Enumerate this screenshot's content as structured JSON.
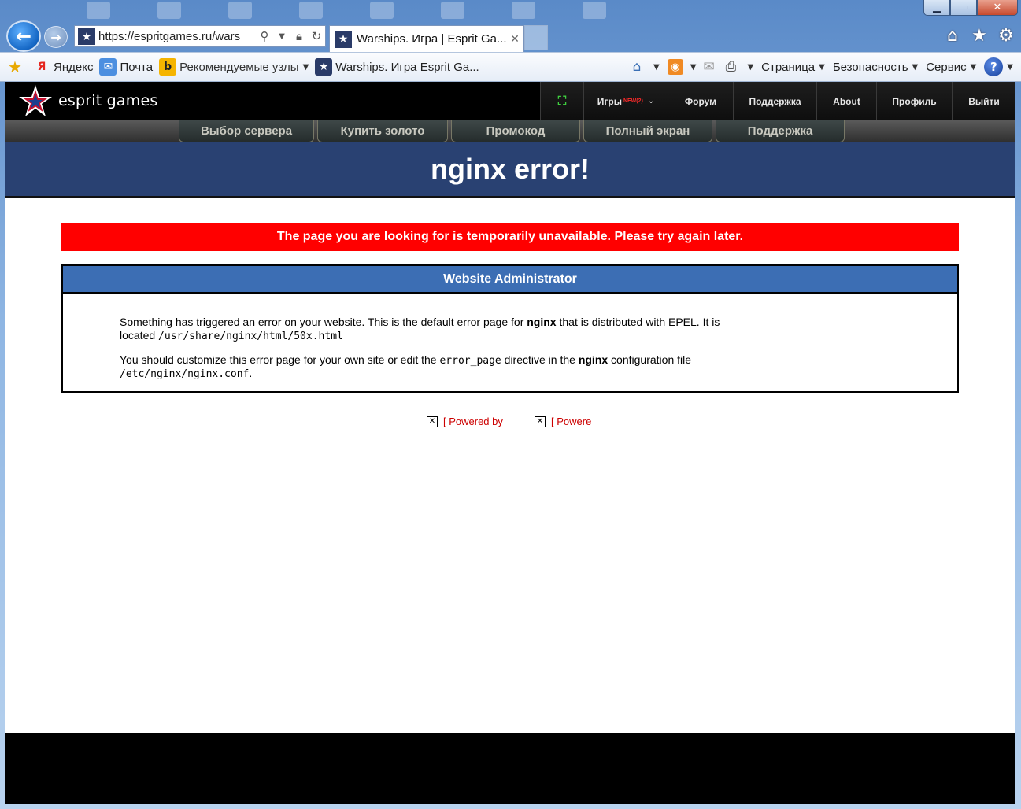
{
  "browser": {
    "address_url": "https://espritgames.ru/wars",
    "tab_title": "Warships. Игра | Esprit Ga...",
    "tab_close": "✕",
    "window_buttons": {
      "minimize": "▁",
      "maximize": "▭",
      "close": "✕"
    },
    "nav_right_icons": [
      "home-icon",
      "favorites-star-icon",
      "settings-gear-icon"
    ]
  },
  "favorites_bar": {
    "items": [
      {
        "label": "Яндекс",
        "icon": "yandex-icon"
      },
      {
        "label": "Почта",
        "icon": "mail-icon"
      },
      {
        "label": "Рекомендуемые узлы",
        "icon": "bing-icon"
      },
      {
        "label": "Warships. Игра  Esprit Ga...",
        "icon": "site-favicon-icon"
      }
    ],
    "commands": {
      "page": "Страница",
      "security": "Безопасность",
      "tools": "Сервис"
    }
  },
  "site": {
    "logo_text": "esprit games",
    "nav": {
      "games": "Игры",
      "games_badge": "NEW(2)",
      "forum": "Форум",
      "support": "Поддержка",
      "about": "About",
      "profile": "Профиль",
      "exit": "Выйти"
    },
    "subnav": [
      "Выбор сервера",
      "Купить золото",
      "Промокод",
      "Полный экран",
      "Поддержка"
    ]
  },
  "error_page": {
    "title": "nginx error!",
    "alert": "The page you are looking for is temporarily unavailable. Please try again later.",
    "admin_header": "Website Administrator",
    "p1_a": "Something has triggered an error on your website. This is the default error page for ",
    "p1_b": "nginx",
    "p1_c": " that is distributed with EPEL. It is located ",
    "p1_path": "/usr/share/nginx/html/50x.html",
    "p2_a": "You should customize this error page for your own site or edit the ",
    "p2_code": "error_page",
    "p2_b": " directive in the ",
    "p2_c": "nginx",
    "p2_d": " configuration file ",
    "p2_path": "/etc/nginx/nginx.conf",
    "p2_end": ".",
    "powered_1": "[ Powered by",
    "powered_2": "[ Powere"
  },
  "colors": {
    "banner": "#294172",
    "alert": "#ff0000",
    "admin_header": "#3c6eb4",
    "powered_text": "#cc0000"
  }
}
